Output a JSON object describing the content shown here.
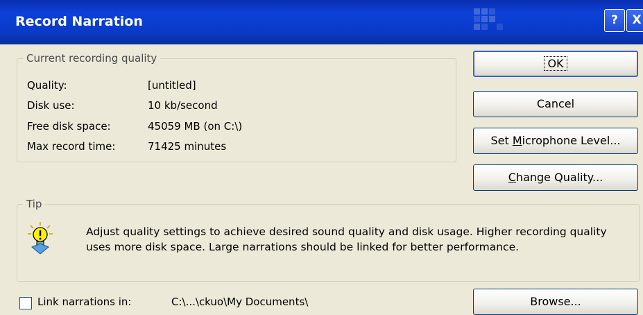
{
  "window": {
    "title": "Record Narration",
    "help_button": "?",
    "close_button": "X"
  },
  "quality_group": {
    "legend": "Current recording quality",
    "rows": [
      {
        "label": "Quality:",
        "value": "[untitled]"
      },
      {
        "label": "Disk use:",
        "value": "10 kb/second"
      },
      {
        "label": "Free disk space:",
        "value": "45059 MB (on C:\\)"
      },
      {
        "label": "Max record time:",
        "value": "71425 minutes"
      }
    ]
  },
  "buttons": {
    "ok": "OK",
    "cancel": "Cancel",
    "set_mic_pre": "Set ",
    "set_mic_key": "M",
    "set_mic_post": "icrophone Level...",
    "change_quality_key": "C",
    "change_quality_post": "hange Quality...",
    "browse": "Browse..."
  },
  "tip_group": {
    "legend": "Tip",
    "text": "Adjust quality settings to achieve desired sound quality and disk usage. Higher recording quality uses more disk space. Large narrations should be linked for better performance.",
    "icon": "lightbulb-tip-icon"
  },
  "link": {
    "label": "Link narrations in:",
    "path": "C:\\...\\ckuo\\My Documents\\",
    "checked": false
  },
  "colors": {
    "titlebar": "#0a3ac8",
    "dialog_bg": "#ece9d8",
    "button_border": "#003c74"
  }
}
